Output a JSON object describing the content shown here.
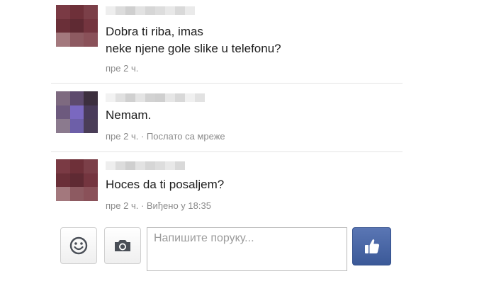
{
  "messages": [
    {
      "lines": [
        "Dobra ti riba, imas",
        "neke njene gole slike u telefonu?"
      ],
      "meta": "пре 2 ч.",
      "avatar_colors": [
        "#7a3a44",
        "#6e3039",
        "#7b3f48",
        "#6a2f38",
        "#5f2a33",
        "#74353f",
        "#a3787d",
        "#8d5a61",
        "#8a5159"
      ],
      "name_blur_colors": [
        "#eeeeee",
        "#dcdcdc",
        "#cfcfcf",
        "#e2e2e2",
        "#d6d6d6",
        "#dddddd",
        "#e8e8e8",
        "#d9d9d9",
        "#eaeaea"
      ]
    },
    {
      "lines": [
        "Nemam."
      ],
      "meta": "пре 2 ч. · Послато са мреже",
      "avatar_colors": [
        "#7e6a80",
        "#5d4a6d",
        "#3c2f3e",
        "#6d5a7e",
        "#7a68c0",
        "#493b5a",
        "#8b7a8e",
        "#6d5fa8",
        "#4a3d57"
      ],
      "name_blur_colors": [
        "#f2f2f2",
        "#e0e0e0",
        "#d0d0d0",
        "#e4e4e4",
        "#d2d2d2",
        "#cfcfcf",
        "#e6e6e6",
        "#d8d8d8",
        "#f0f0f0",
        "#e2e2e2"
      ]
    },
    {
      "lines": [
        "Hoces da ti posaljem?"
      ],
      "meta": "пре 2 ч. · Виђено у 18:35",
      "avatar_colors": [
        "#7a3a44",
        "#6e3039",
        "#7b3f48",
        "#6a2f38",
        "#5f2a33",
        "#74353f",
        "#a3787d",
        "#8d5a61",
        "#8a5159"
      ],
      "name_blur_colors": [
        "#eeeeee",
        "#dcdcdc",
        "#cfcfcf",
        "#e2e2e2",
        "#d6d6d6",
        "#dddddd",
        "#e8e8e8",
        "#d9d9d9"
      ]
    }
  ],
  "composer": {
    "placeholder": "Напишите поруку...",
    "emoji_icon": "smiley-icon",
    "camera_icon": "camera-icon",
    "like_icon": "thumbs-up-icon"
  },
  "colors": {
    "like_button": "#3b5998",
    "meta_text": "#8a8a8a"
  }
}
